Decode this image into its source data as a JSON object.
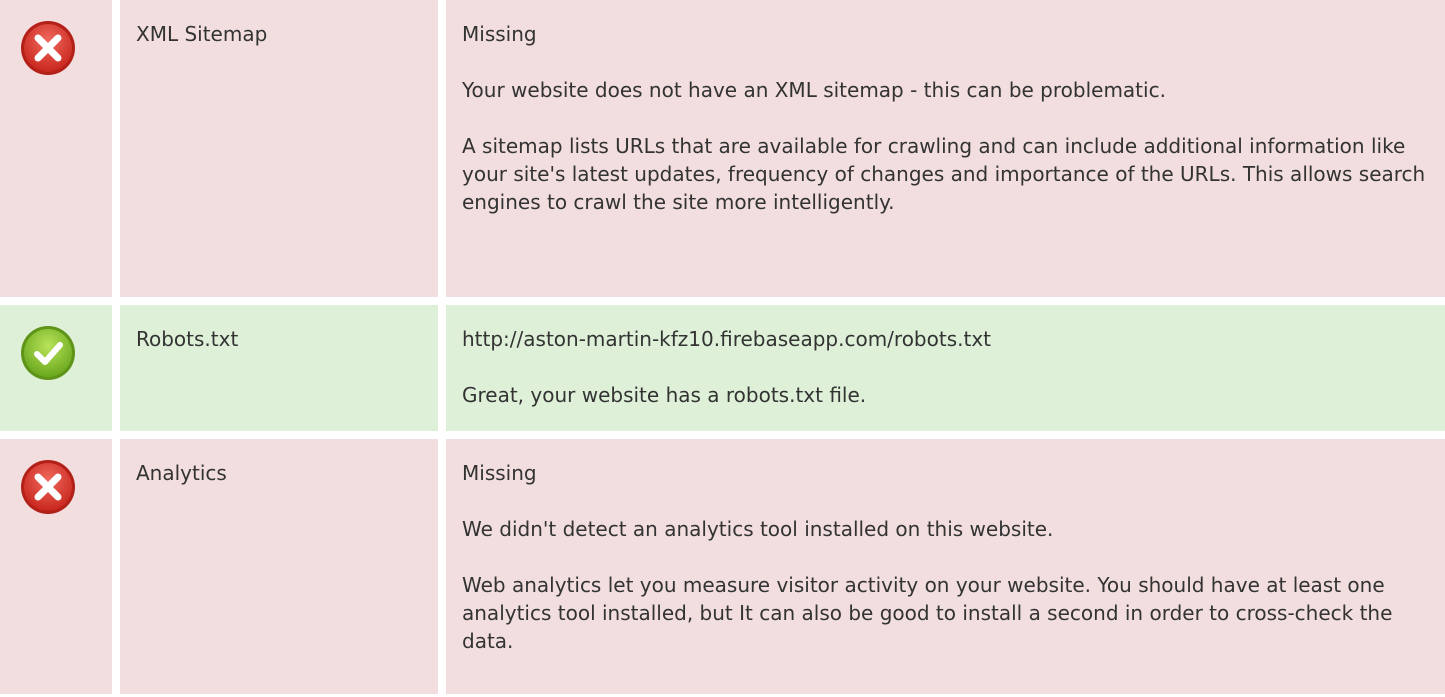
{
  "rows": [
    {
      "status": "fail",
      "icon": "error-cross-icon",
      "name": "XML Sitemap",
      "value": "Missing",
      "paragraphs": [
        "Your website does not have an XML sitemap - this can be problematic.",
        "A sitemap lists URLs that are available for crawling and can include additional information like your site's latest updates, frequency of changes and importance of the URLs. This allows search engines to crawl the site more intelligently."
      ]
    },
    {
      "status": "pass",
      "icon": "success-check-icon",
      "name": "Robots.txt",
      "value": "http://aston-martin-kfz10.firebaseapp.com/robots.txt",
      "paragraphs": [
        "Great, your website has a robots.txt file."
      ]
    },
    {
      "status": "fail",
      "icon": "error-cross-icon",
      "name": "Analytics",
      "value": "Missing",
      "paragraphs": [
        "We didn't detect an analytics tool installed on this website.",
        "Web analytics let you measure visitor activity on your website. You should have at least one analytics tool installed, but It can also be good to install a second in order to cross-check the data."
      ]
    }
  ],
  "colors": {
    "fail_bg": "#f2dede",
    "pass_bg": "#dff0d8",
    "fail_icon": "#d9342b",
    "pass_icon": "#7cbf2a",
    "text": "#333333"
  }
}
